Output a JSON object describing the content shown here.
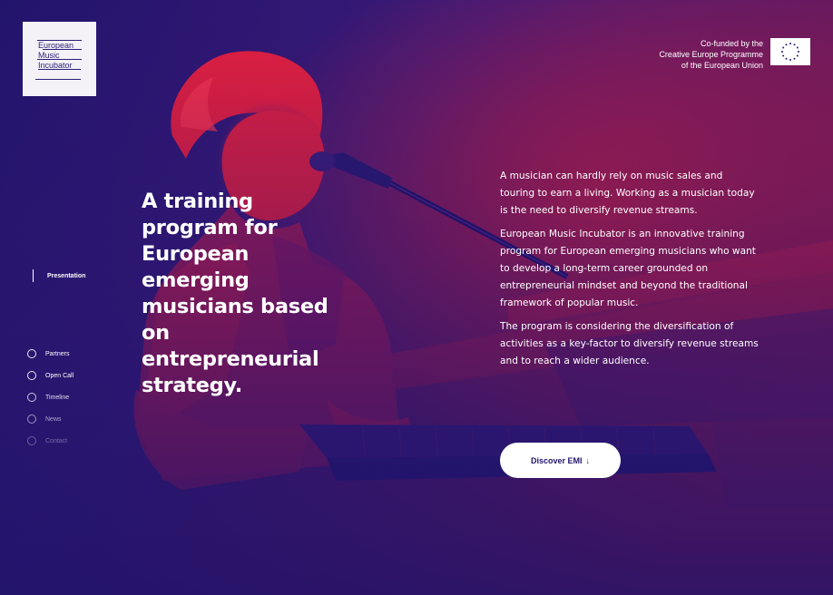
{
  "logo": {
    "lines": [
      "European",
      "Music",
      "Incubator"
    ]
  },
  "funding": {
    "lines": [
      "Co-funded by the",
      "Creative Europe Programme",
      "of the European Union"
    ]
  },
  "nav": {
    "active": "Presentation",
    "items": [
      {
        "label": "Partners"
      },
      {
        "label": "Open Call"
      },
      {
        "label": "Timeline"
      },
      {
        "label": "News"
      },
      {
        "label": "Contact"
      }
    ]
  },
  "hero": {
    "headline": "A training program for European emerging musicians based on entrepreneurial strategy.",
    "paragraphs": [
      "A musician can hardly rely on music sales and touring to earn a living. Working as a musician today is the need to diversify revenue streams.",
      "European Music Incubator is an innovative training program for European emerging musicians who want to develop a long-term career grounded on entrepreneurial mindset and beyond the traditional framework of popular music.",
      "The program is considering the diversification of activities as a key-factor to diversify revenue streams and to reach a wider audience."
    ],
    "cta_label": "Discover EMI",
    "cta_arrow": "↓"
  },
  "colors": {
    "deep_blue": "#24166e",
    "red": "#e8203c",
    "white": "#ffffff"
  },
  "icons": {
    "eu_flag": "eu-flag-icon",
    "arrow": "arrow-down-icon",
    "nav_marker": "circle-icon"
  }
}
